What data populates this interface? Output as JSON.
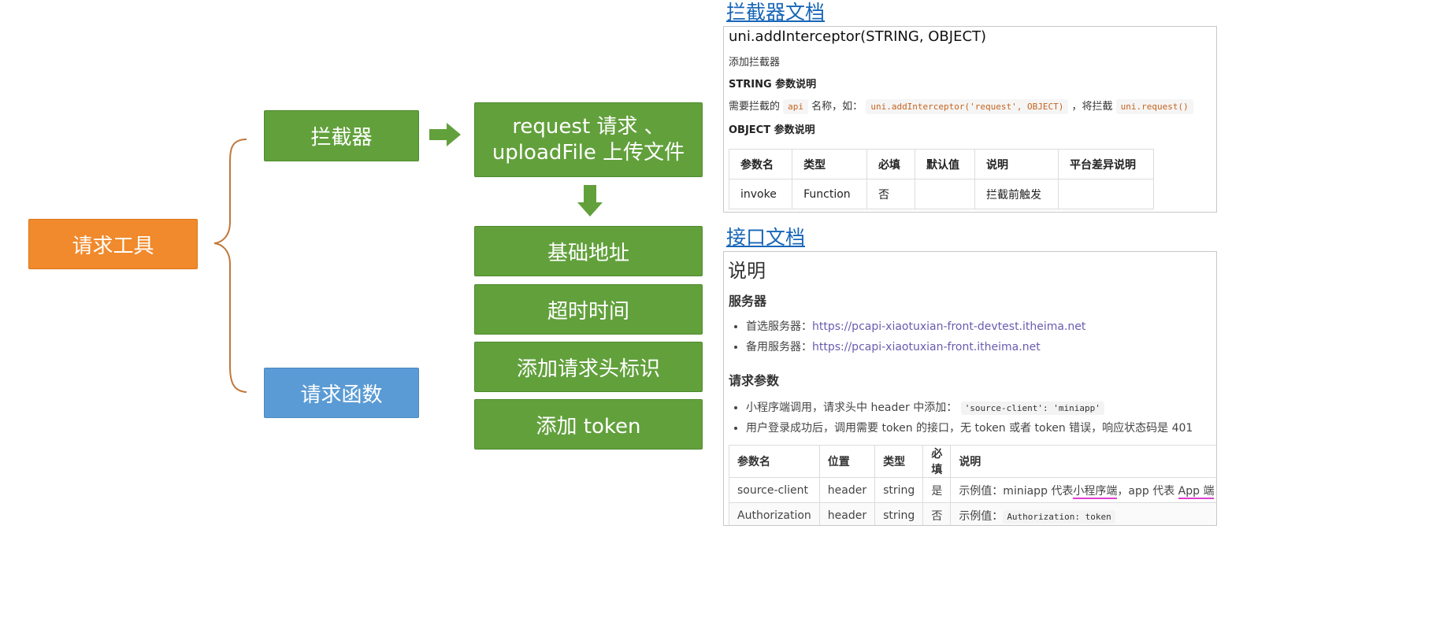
{
  "diagram": {
    "root": "请求工具",
    "interceptor": "拦截器",
    "request_fn": "请求函数",
    "target_line1": "request 请求 、",
    "target_line2": "uploadFile 上传文件",
    "steps": [
      "基础地址",
      "超时时间",
      "添加请求头标识",
      "添加 token"
    ],
    "colors": {
      "green": "#62a03c",
      "orange": "#f08a2c",
      "blue": "#5b9bd5",
      "brace": "#c0783a"
    }
  },
  "interceptor_doc": {
    "link": "拦截器文档",
    "signature": "uni.addInterceptor(STRING, OBJECT)",
    "desc": "添加拦截器",
    "string_heading": "STRING 参数说明",
    "string_text1": "需要拦截的",
    "string_code1": "api",
    "string_text2": "名称，如：",
    "string_code2": "uni.addInterceptor('request', OBJECT)",
    "string_text3": "，将拦截",
    "string_code3": "uni.request()",
    "object_heading": "OBJECT 参数说明",
    "table_headers": [
      "参数名",
      "类型",
      "必填",
      "默认值",
      "说明",
      "平台差异说明"
    ],
    "table_rows": [
      [
        "invoke",
        "Function",
        "否",
        "",
        "拦截前触发",
        ""
      ]
    ]
  },
  "api_doc": {
    "link": "接口文档",
    "title": "说明",
    "server_heading": "服务器",
    "servers": [
      {
        "label": "首选服务器：",
        "url": "https://pcapi-xiaotuxian-front-devtest.itheima.net"
      },
      {
        "label": "备用服务器：",
        "url": "https://pcapi-xiaotuxian-front.itheima.net"
      }
    ],
    "params_heading": "请求参数",
    "bullet1_text": "小程序端调用，请求头中 header 中添加：",
    "bullet1_code": "'source-client': 'miniapp'",
    "bullet2_text": "用户登录成功后，调用需要 token 的接口，无 token 或者 token 错误，响应状态码是 401",
    "table_headers": [
      "参数名",
      "位置",
      "类型",
      "必填",
      "说明"
    ],
    "row1": [
      "source-client",
      "header",
      "string",
      "是"
    ],
    "row1_desc_a": "示例值：miniapp 代表",
    "row1_desc_b": "小程序端",
    "row1_desc_c": "，app 代表 ",
    "row1_desc_d": "App 端",
    "row2": [
      "Authorization",
      "header",
      "string",
      "否"
    ],
    "row2_desc": "示例值：",
    "row2_code": "Authorization: token",
    "highlight_color": "#e040d0"
  }
}
